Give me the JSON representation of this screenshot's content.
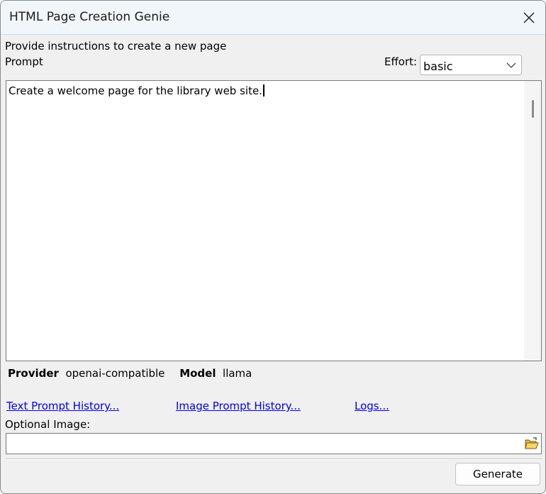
{
  "window": {
    "title": "HTML Page Creation Genie"
  },
  "form": {
    "instructions": "Provide instructions to create a new page",
    "prompt_label": "Prompt",
    "effort_label": "Effort:",
    "effort_value": "basic",
    "prompt_text": "Create a welcome page for the library web site."
  },
  "info": {
    "provider_label": "Provider",
    "provider_value": "openai-compatible",
    "model_label": "Model",
    "model_value": "llama"
  },
  "links": {
    "text_history": "Text Prompt History...",
    "image_history": "Image Prompt History...",
    "logs": "Logs..."
  },
  "image": {
    "label": "Optional Image:",
    "value": ""
  },
  "actions": {
    "generate_label": "Generate"
  },
  "icons": {
    "close": "close-icon",
    "dropdown": "chevron-down-icon",
    "browse": "folder-open-icon"
  }
}
